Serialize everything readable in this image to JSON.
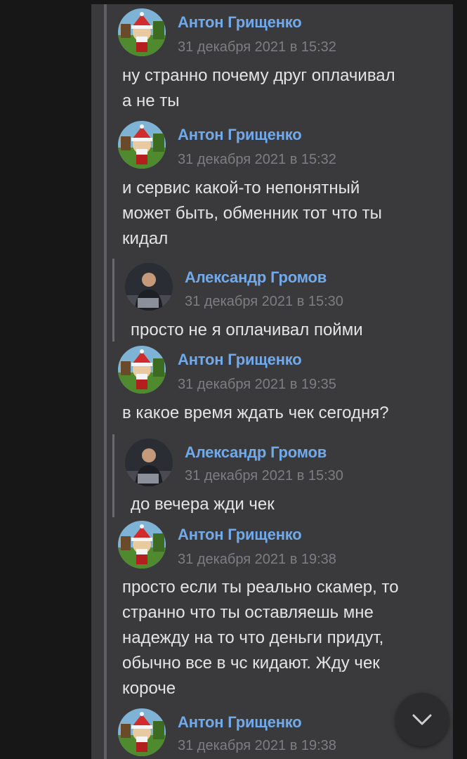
{
  "messages": [
    {
      "author": "Антон Грищенко",
      "date": "31 декабря 2021 в 15:32",
      "text": "ну странно почему друг оплачивал\nа не ты"
    },
    {
      "author": "Антон Грищенко",
      "date": "31 декабря 2021 в 15:32",
      "text": "и сервис какой-то непонятный\nможет быть, обменник тот что ты\nкидал",
      "quote": {
        "author": "Александр Громов",
        "date": "31 декабря 2021 в 15:30",
        "text": "просто не я оплачивал пойми"
      }
    },
    {
      "author": "Антон Грищенко",
      "date": "31 декабря 2021 в 19:35",
      "text": "в какое время ждать чек сегодня?",
      "quote": {
        "author": "Александр Громов",
        "date": "31 декабря 2021 в 15:30",
        "text": "до вечера жди чек"
      }
    },
    {
      "author": "Антон Грищенко",
      "date": "31 декабря 2021 в 19:38",
      "text": "просто если ты реально скамер, то\nстранно что ты оставляешь мне\nнадежду на то что деньги придут,\nобычно все в чс кидают. Жду чек\nкороче"
    },
    {
      "author": "Антон Грищенко",
      "date": "31 декабря 2021 в 19:38"
    }
  ],
  "scroll_button": {
    "icon": "chevron-down-icon"
  }
}
